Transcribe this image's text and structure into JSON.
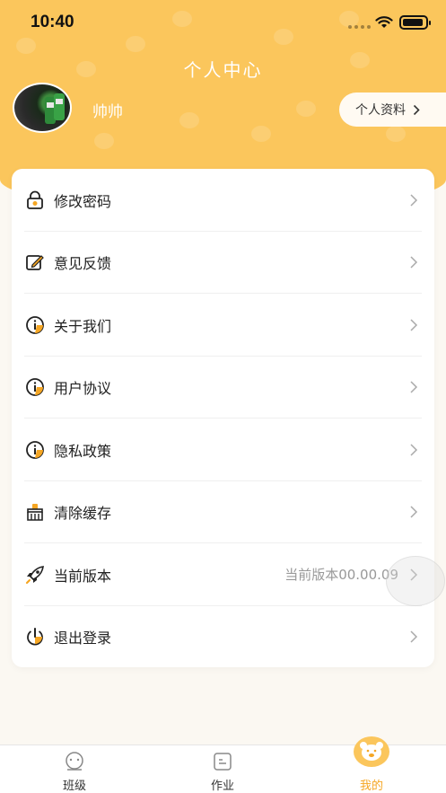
{
  "status_bar": {
    "time": "10:40"
  },
  "header": {
    "title": "个人中心",
    "username": "帅帅",
    "profile_button": "个人资料"
  },
  "menu": {
    "items": [
      {
        "label": "修改密码",
        "icon": "lock-icon"
      },
      {
        "label": "意见反馈",
        "icon": "edit-icon"
      },
      {
        "label": "关于我们",
        "icon": "info-icon"
      },
      {
        "label": "用户协议",
        "icon": "info-icon"
      },
      {
        "label": "隐私政策",
        "icon": "info-icon"
      },
      {
        "label": "清除缓存",
        "icon": "broom-icon"
      },
      {
        "label": "当前版本",
        "icon": "rocket-icon",
        "value": "当前版本00.00.09"
      },
      {
        "label": "退出登录",
        "icon": "power-icon"
      }
    ]
  },
  "tabbar": {
    "tabs": [
      {
        "label": "班级",
        "icon": "class-icon"
      },
      {
        "label": "作业",
        "icon": "homework-icon"
      },
      {
        "label": "我的",
        "icon": "bear-icon",
        "active": true
      }
    ]
  },
  "colors": {
    "accent": "#fbc65c",
    "active_tab": "#f5a623"
  }
}
